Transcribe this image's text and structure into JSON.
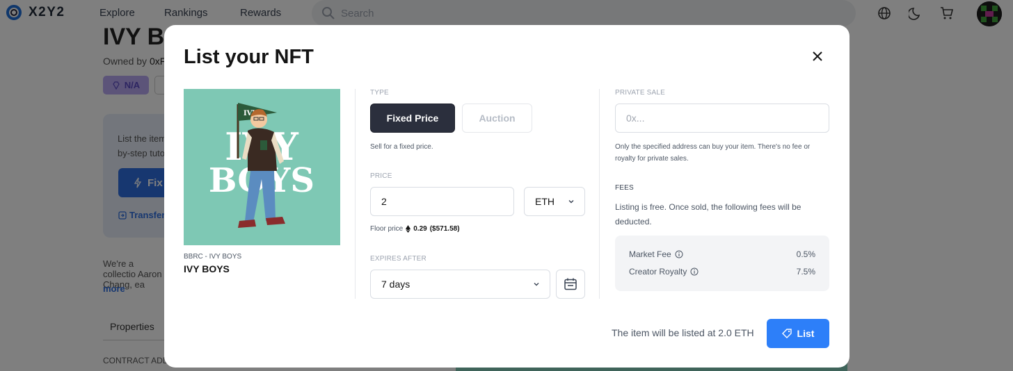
{
  "topbar": {
    "brand": "X2Y2",
    "nav": [
      "Explore",
      "Rankings",
      "Rewards"
    ],
    "search_placeholder": "Search"
  },
  "background": {
    "title": "IVY B",
    "owned_by_label": "Owned by",
    "owner": "0xF",
    "rarity_badge": "N/A",
    "panel_text": "List the item by-step tuto",
    "fixed_button": "Fix",
    "transfer_link": "Transfer",
    "description": "We're a collectio Aaron Chang, ea",
    "more_link": "more",
    "properties_tab": "Properties",
    "contract_label": "CONTRACT ADD"
  },
  "modal": {
    "title": "List your NFT",
    "nft": {
      "collection": "BBRC - IVY BOYS",
      "name": "IVY BOYS",
      "artwork_text": [
        "IVY",
        "BOYS"
      ],
      "flag_text": "IVY"
    },
    "type": {
      "label": "TYPE",
      "options": [
        "Fixed Price",
        "Auction"
      ],
      "selected": "Fixed Price",
      "hint": "Sell for a fixed price."
    },
    "price": {
      "label": "PRICE",
      "value": "2",
      "currency": "ETH",
      "floor_label": "Floor price",
      "floor_value": "0.29",
      "floor_usd": "($571.58)"
    },
    "expires": {
      "label": "EXPIRES AFTER",
      "value": "7 days"
    },
    "private_sale": {
      "label": "PRIVATE SALE",
      "placeholder": "0x...",
      "hint": "Only the specified address can buy your item. There's no fee or royalty for private sales."
    },
    "fees": {
      "label": "FEES",
      "description": "Listing is free. Once sold, the following fees will be deducted.",
      "rows": [
        {
          "name": "Market Fee",
          "value": "0.5%"
        },
        {
          "name": "Creator Royalty",
          "value": "7.5%"
        }
      ]
    },
    "footer": {
      "summary": "The item will be listed at 2.0 ETH",
      "list_button": "List"
    }
  },
  "colors": {
    "primary": "#2d7ff9",
    "dark_button": "#2b2f3d",
    "nft_background": "#7ec8b4"
  },
  "icons": [
    "search-icon",
    "globe-icon",
    "moon-icon",
    "cart-icon",
    "close-icon",
    "chevron-down-icon",
    "calendar-icon",
    "info-icon",
    "tag-icon",
    "eth-icon"
  ]
}
